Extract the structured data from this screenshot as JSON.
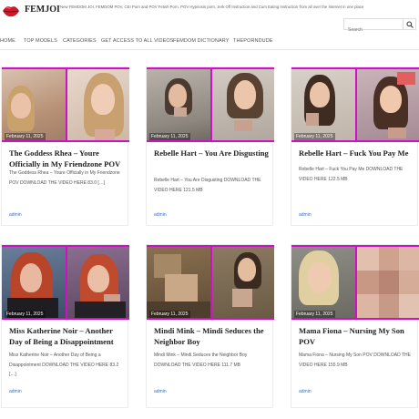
{
  "header": {
    "site_title": "FEMJOI",
    "tagline": "New FEMDOM JOI, FEMDOM POV, CEI Porn and POV Fetish Porn, POV Hypnosis porn, Jerk Off Instruction and Cum Eating Instruction from all over the Internet in one place",
    "search_placeholder": "Search"
  },
  "nav": {
    "items": [
      "HOME",
      "TOP MODELS",
      "CATEGORIES",
      "GET ACCESS TO ALL VIDEOS",
      "FEMDOM DICTIONARY",
      "THEPORNDUDE"
    ]
  },
  "posts": [
    {
      "date": "February 11, 2025",
      "title": "The Goddess Rhea – Youre Officially in My Friendzone POV",
      "excerpt": "The Goddess Rhea – Youre Officially in My Friendzone POV DOWNLOAD THE VIDEO HERE 83.0 […]",
      "author": "admin"
    },
    {
      "date": "February 11, 2025",
      "title": "Rebelle Hart – You Are Disgusting",
      "excerpt": "Rebelle Hart – You Are Disgusting DOWNLOAD THE VIDEO HERE 121.5 MB",
      "author": "admin"
    },
    {
      "date": "February 11, 2025",
      "title": "Rebelle Hart – Fuck You Pay Me",
      "excerpt": "Rebelle Hart – Fuck You Pay Me DOWNLOAD THE VIDEO HERE 122.5 MB",
      "author": "admin"
    },
    {
      "date": "February 11, 2025",
      "title": "Miss Katherine Noir – Another Day of Being a Disappointment",
      "excerpt": "Miss Katherine Noir – Another Day of Being a Disappointment DOWNLOAD THE VIDEO HERE 83.2 […]",
      "author": "admin"
    },
    {
      "date": "February 11, 2025",
      "title": "Mindi Mink – Mindi Seduces the Neighbor Boy",
      "excerpt": "Mindi Mink – Mindi Seduces the Neighbor Boy DOWNLOAD THE VIDEO HERE 111.7 MB",
      "author": "admin"
    },
    {
      "date": "February 11, 2025",
      "title": "Mama Fiona – Nursing My Son POV",
      "excerpt": "Mama Fiona – Nursing My Son POV DOWNLOAD THE VIDEO HERE 155.9 MB",
      "author": "admin"
    }
  ],
  "colors": {
    "accent": "#d010c8",
    "link": "#3a6fb0",
    "logo_red": "#d01828"
  }
}
